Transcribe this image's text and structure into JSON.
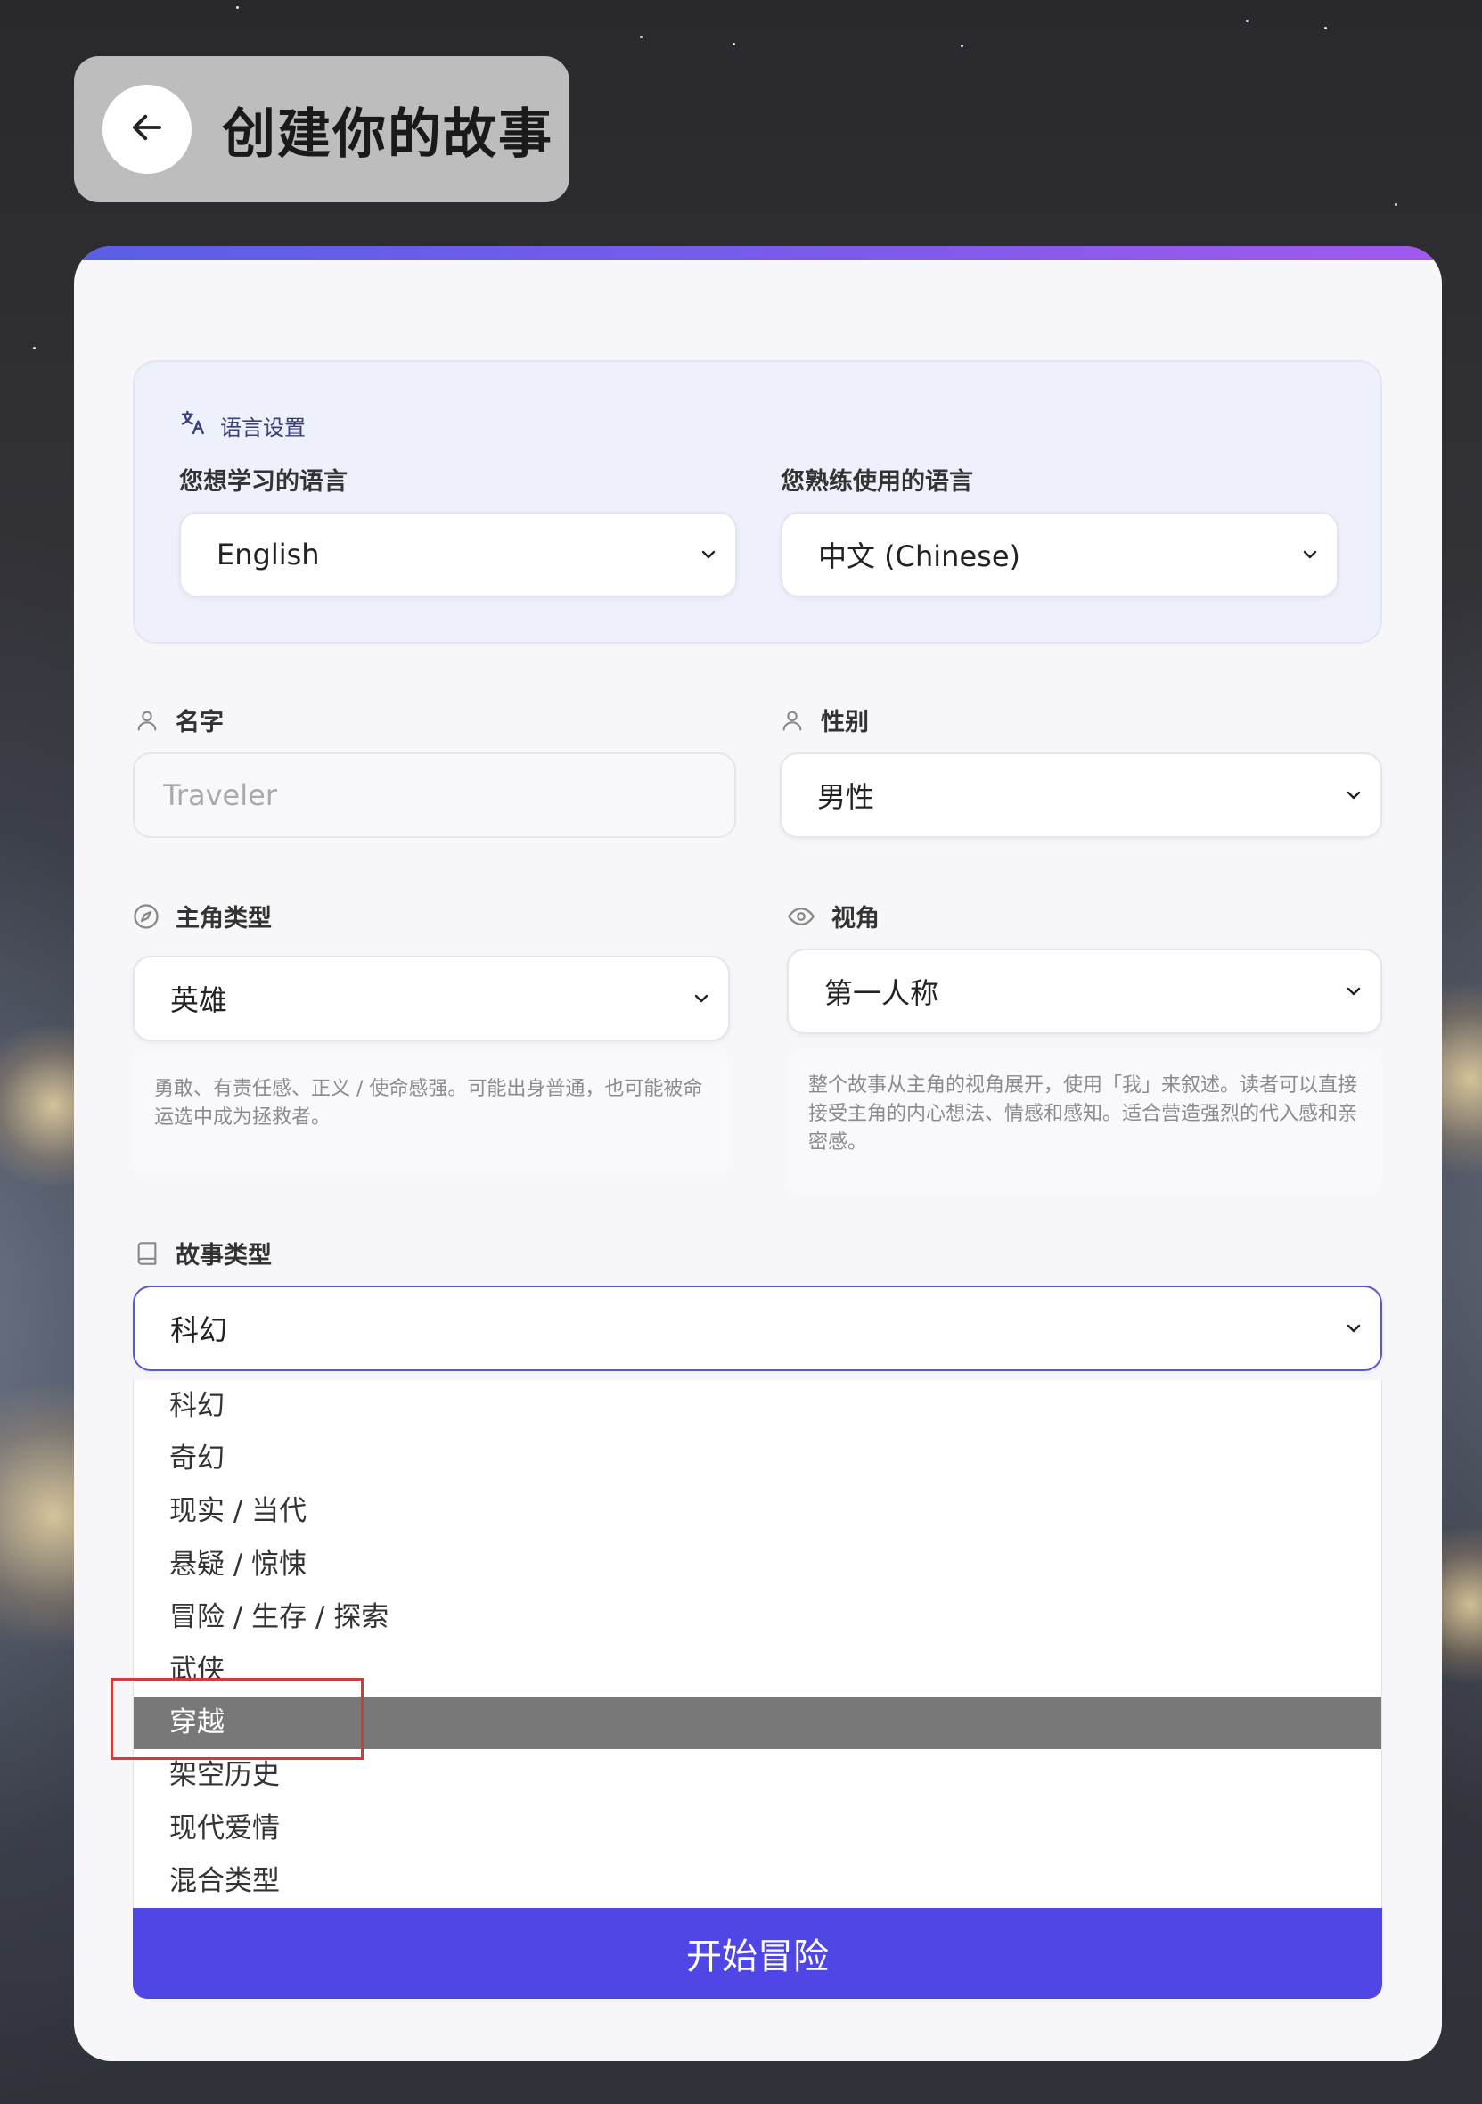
{
  "header": {
    "title": "创建你的故事"
  },
  "language": {
    "section_title": "语言设置",
    "learn_label": "您想学习的语言",
    "learn_value": "English",
    "native_label": "您熟练使用的语言",
    "native_value": "中文 (Chinese)"
  },
  "name": {
    "label": "名字",
    "placeholder": "Traveler"
  },
  "gender": {
    "label": "性别",
    "value": "男性"
  },
  "protagonist": {
    "label": "主角类型",
    "value": "英雄",
    "description": "勇敢、有责任感、正义 / 使命感强。可能出身普通，也可能被命运选中成为拯救者。"
  },
  "perspective": {
    "label": "视角",
    "value": "第一人称",
    "description": "整个故事从主角的视角展开，使用「我」来叙述。读者可以直接接受主角的内心想法、情感和感知。适合营造强烈的代入感和亲密感。"
  },
  "story_type": {
    "label": "故事类型",
    "value": "科幻",
    "options": [
      "科幻",
      "奇幻",
      "现实 / 当代",
      "悬疑 / 惊悚",
      "冒险 / 生存 / 探索",
      "武侠",
      "穿越",
      "架空历史",
      "现代爱情",
      "混合类型"
    ],
    "highlighted_option": "穿越"
  },
  "start_button": "开始冒险",
  "colors": {
    "accent": "#4f46e5",
    "gradient_start": "#5a5fe6",
    "gradient_end": "#a259f0",
    "highlight": "#787878",
    "annotation": "#d33a3a"
  },
  "icons": {
    "back": "arrow-left-icon",
    "language": "translate-icon",
    "name": "user-icon",
    "gender": "user-icon",
    "protagonist": "compass-icon",
    "perspective": "eye-icon",
    "story_type": "book-icon",
    "dropdown": "chevron-down-icon"
  }
}
